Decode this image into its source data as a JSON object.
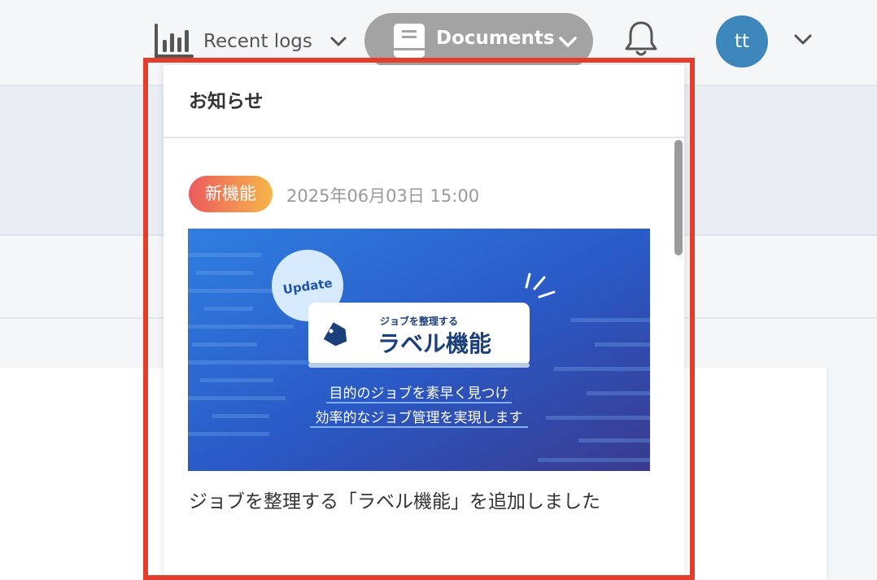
{
  "header": {
    "recent_logs_label": "Recent logs",
    "documents_label": "Documents",
    "user_initials": "tt"
  },
  "notifications": {
    "title": "お知らせ",
    "items": [
      {
        "badge": "新機能",
        "date": "2025年06月03日 15:00",
        "banner": {
          "update_label": "Update",
          "card_small": "ジョブを整理する",
          "card_large": "ラベル機能",
          "line1": "目的のジョブを素早く見つけ",
          "line2": "効率的なジョブ管理を実現します"
        },
        "title": "ジョブを整理する「ラベル機能」を追加しました"
      }
    ]
  },
  "colors": {
    "highlight": "#e33d2b",
    "avatar": "#3d87bd",
    "badge_gradient_start": "#eb5a5e",
    "badge_gradient_end": "#f6b648"
  }
}
